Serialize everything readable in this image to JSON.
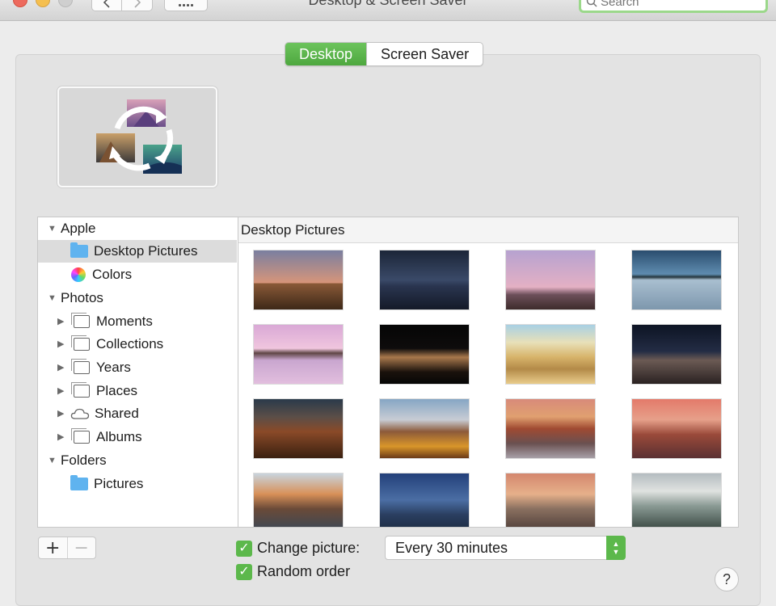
{
  "window": {
    "title": "Desktop & Screen Saver"
  },
  "toolbar": {
    "search_placeholder": "Search"
  },
  "tabs": [
    {
      "label": "Desktop",
      "active": true
    },
    {
      "label": "Screen Saver",
      "active": false
    }
  ],
  "sidebar": {
    "items": [
      {
        "label": "Apple",
        "type": "group",
        "disclosure": "open"
      },
      {
        "label": "Desktop Pictures",
        "type": "folder",
        "selected": true
      },
      {
        "label": "Colors",
        "type": "colors"
      },
      {
        "label": "Photos",
        "type": "group",
        "disclosure": "open"
      },
      {
        "label": "Moments",
        "type": "album",
        "disclosure": "closed"
      },
      {
        "label": "Collections",
        "type": "album",
        "disclosure": "closed"
      },
      {
        "label": "Years",
        "type": "album",
        "disclosure": "closed"
      },
      {
        "label": "Places",
        "type": "album",
        "disclosure": "closed"
      },
      {
        "label": "Shared",
        "type": "cloud",
        "disclosure": "closed"
      },
      {
        "label": "Albums",
        "type": "album",
        "disclosure": "closed"
      },
      {
        "label": "Folders",
        "type": "group",
        "disclosure": "open"
      },
      {
        "label": "Pictures",
        "type": "folder"
      }
    ]
  },
  "content": {
    "header": "Desktop Pictures"
  },
  "options": {
    "change_picture_label": "Change picture:",
    "change_picture_checked": true,
    "interval_value": "Every 30 minutes",
    "random_order_label": "Random order",
    "random_order_checked": true
  },
  "buttons": {
    "add": "+",
    "remove": "−",
    "help": "?"
  },
  "colors": {
    "accent_green": "#5cb84b",
    "selection_gray": "#dcdcdc",
    "folder_blue": "#5fb3ef"
  }
}
